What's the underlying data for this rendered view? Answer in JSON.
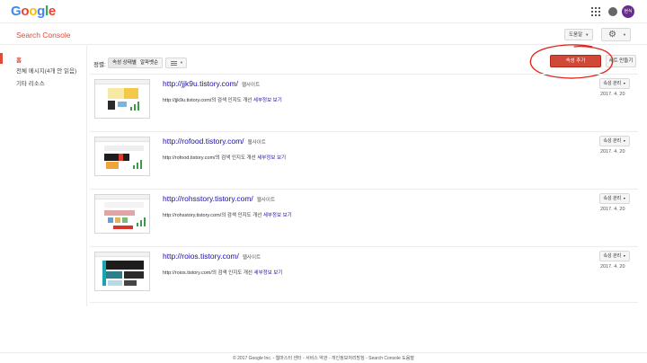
{
  "header": {
    "logo_letters": [
      "G",
      "o",
      "o",
      "g",
      "l",
      "e"
    ],
    "logo_colors": [
      "#4285f4",
      "#ea4335",
      "#fbbc05",
      "#4285f4",
      "#34a853",
      "#ea4335"
    ],
    "avatar_text": "현식"
  },
  "subbar": {
    "product_name": "Search Console",
    "help_label": "도움말"
  },
  "sidebar": {
    "items": [
      {
        "label": "홈",
        "active": true
      },
      {
        "label": "전체 메시지(4개 안 읽음)",
        "active": false
      },
      {
        "label": "기타 리소스",
        "active": false
      }
    ]
  },
  "toolbar": {
    "sort_label": "정렬:",
    "sort_options": [
      "속성 상태별",
      "알파벳순"
    ],
    "add_property_label": "속성 추가",
    "create_group_label": "세트 만들기"
  },
  "properties": [
    {
      "url": "http://jjk9u.tistory.com/",
      "type": "웹사이트",
      "desc_prefix": "http://jjk9u.tistory.com/의 검색 인지도 개선",
      "desc_link": "세부정보 보기",
      "manage_label": "속성 관리",
      "date": "2017. 4. 20"
    },
    {
      "url": "http://rofood.tistory.com/",
      "type": "웹사이트",
      "desc_prefix": "http://rofood.tistory.com/의 검색 인지도 개선",
      "desc_link": "세부정보 보기",
      "manage_label": "속성 관리",
      "date": "2017. 4. 20"
    },
    {
      "url": "http://rohsstory.tistory.com/",
      "type": "웹사이트",
      "desc_prefix": "http://rohsstory.tistory.com/의 검색 인지도 개선",
      "desc_link": "세부정보 보기",
      "manage_label": "속성 관리",
      "date": "2017. 4. 20"
    },
    {
      "url": "http://roios.tistory.com/",
      "type": "웹사이트",
      "desc_prefix": "http://roios.tistory.com/의 검색 인지도 개선",
      "desc_link": "세부정보 보기",
      "manage_label": "속성 관리",
      "date": "2017. 4. 20"
    }
  ],
  "footer": {
    "text": "© 2017 Google Inc. - 웹마스터 센터 - 서비스 약관 - 개인정보처리방침 - Search Console 도움말"
  },
  "colors": {
    "accent_red": "#dd4b39",
    "button_red": "#d14836",
    "link_blue": "#1a0dab",
    "annotation_red": "#e0241b"
  }
}
